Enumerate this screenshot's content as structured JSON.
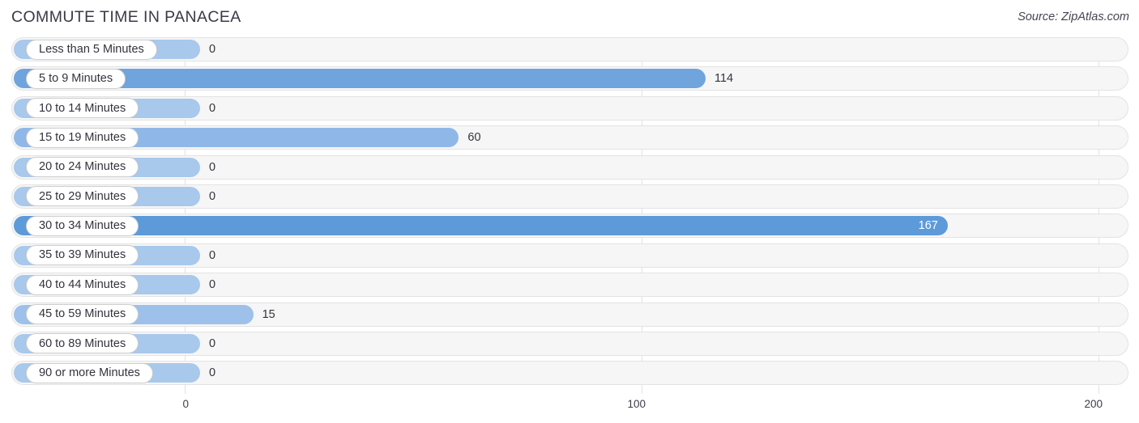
{
  "header": {
    "title": "COMMUTE TIME IN PANACEA",
    "source": "Source: ZipAtlas.com"
  },
  "axis": {
    "ticks": [
      "0",
      "100",
      "200"
    ],
    "min": 0,
    "max": 200
  },
  "chart_data": {
    "type": "bar",
    "orientation": "horizontal",
    "title": "COMMUTE TIME IN PANACEA",
    "subtitle": "Source: ZipAtlas.com",
    "xlabel": "",
    "ylabel": "",
    "xlim": [
      0,
      200
    ],
    "xticks": [
      0,
      100,
      200
    ],
    "grid": true,
    "legend": false,
    "categories": [
      "Less than 5 Minutes",
      "5 to 9 Minutes",
      "10 to 14 Minutes",
      "15 to 19 Minutes",
      "20 to 24 Minutes",
      "25 to 29 Minutes",
      "30 to 34 Minutes",
      "35 to 39 Minutes",
      "40 to 44 Minutes",
      "45 to 59 Minutes",
      "60 to 89 Minutes",
      "90 or more Minutes"
    ],
    "values": [
      0,
      114,
      0,
      60,
      0,
      0,
      167,
      0,
      0,
      15,
      0,
      0
    ],
    "value_labels": [
      "0",
      "114",
      "0",
      "60",
      "0",
      "0",
      "167",
      "0",
      "0",
      "15",
      "0",
      "0"
    ]
  },
  "rows": [
    {
      "label": "Less than 5 Minutes",
      "value": 0,
      "value_label": "0",
      "color": "#a8c8ec",
      "label_inside": false
    },
    {
      "label": "5 to 9 Minutes",
      "value": 114,
      "value_label": "114",
      "color": "#6fa4dd",
      "label_inside": false
    },
    {
      "label": "10 to 14 Minutes",
      "value": 0,
      "value_label": "0",
      "color": "#a8c8ec",
      "label_inside": false
    },
    {
      "label": "15 to 19 Minutes",
      "value": 60,
      "value_label": "60",
      "color": "#8fb8e8",
      "label_inside": false
    },
    {
      "label": "20 to 24 Minutes",
      "value": 0,
      "value_label": "0",
      "color": "#a8c8ec",
      "label_inside": false
    },
    {
      "label": "25 to 29 Minutes",
      "value": 0,
      "value_label": "0",
      "color": "#a8c8ec",
      "label_inside": false
    },
    {
      "label": "30 to 34 Minutes",
      "value": 167,
      "value_label": "167",
      "color": "#5d9ada",
      "label_inside": true
    },
    {
      "label": "35 to 39 Minutes",
      "value": 0,
      "value_label": "0",
      "color": "#a8c8ec",
      "label_inside": false
    },
    {
      "label": "40 to 44 Minutes",
      "value": 0,
      "value_label": "0",
      "color": "#a8c8ec",
      "label_inside": false
    },
    {
      "label": "45 to 59 Minutes",
      "value": 15,
      "value_label": "15",
      "color": "#9dc1ea",
      "label_inside": false
    },
    {
      "label": "60 to 89 Minutes",
      "value": 0,
      "value_label": "0",
      "color": "#a8c8ec",
      "label_inside": false
    },
    {
      "label": "90 or more Minutes",
      "value": 0,
      "value_label": "0",
      "color": "#a8c8ec",
      "label_inside": false
    }
  ]
}
